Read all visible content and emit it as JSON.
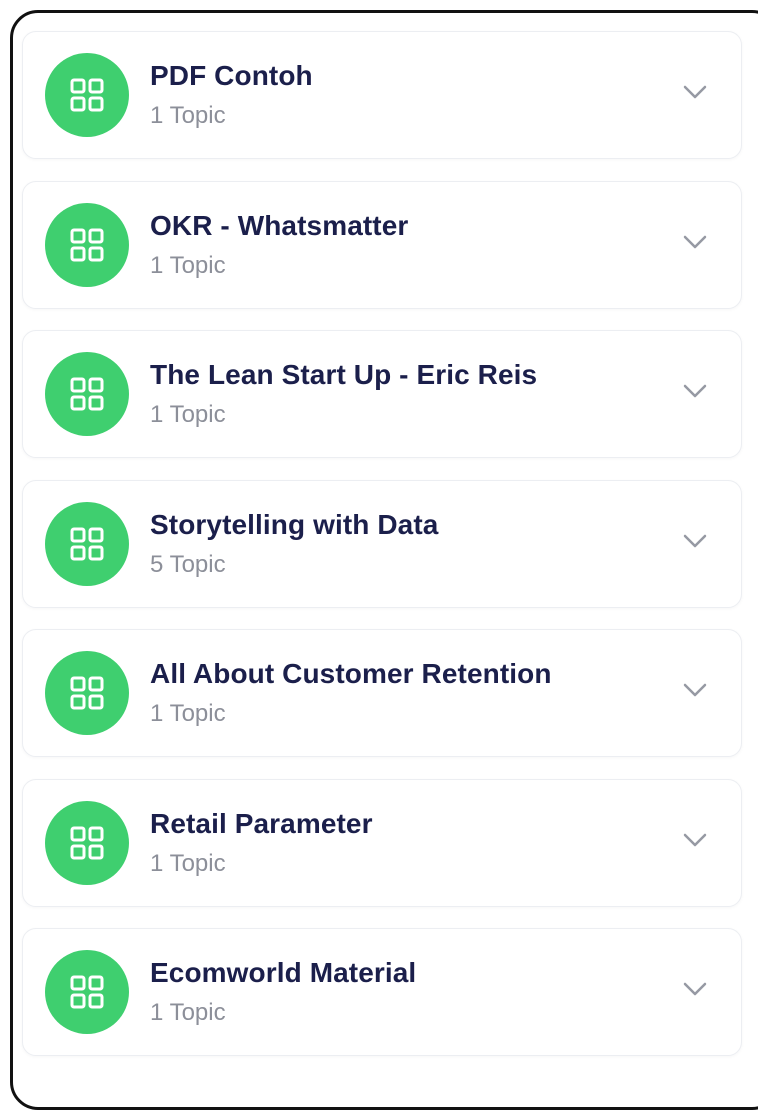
{
  "colors": {
    "accent": "#3fcf6f",
    "title": "#1b1f4b",
    "subtitle": "#8c8f99",
    "chevron": "#9699a3"
  },
  "modules": [
    {
      "title": "PDF Contoh",
      "topics": "1 Topic",
      "icon": "grid-icon"
    },
    {
      "title": "OKR - Whatsmatter",
      "topics": "1 Topic",
      "icon": "grid-icon"
    },
    {
      "title": "The Lean Start Up - Eric Reis",
      "topics": "1 Topic",
      "icon": "grid-icon"
    },
    {
      "title": "Storytelling with Data",
      "topics": "5 Topic",
      "icon": "grid-icon"
    },
    {
      "title": "All About Customer Retention",
      "topics": "1 Topic",
      "icon": "grid-icon"
    },
    {
      "title": "Retail Parameter",
      "topics": "1 Topic",
      "icon": "grid-icon"
    },
    {
      "title": "Ecomworld Material",
      "topics": "1 Topic",
      "icon": "grid-icon"
    }
  ]
}
